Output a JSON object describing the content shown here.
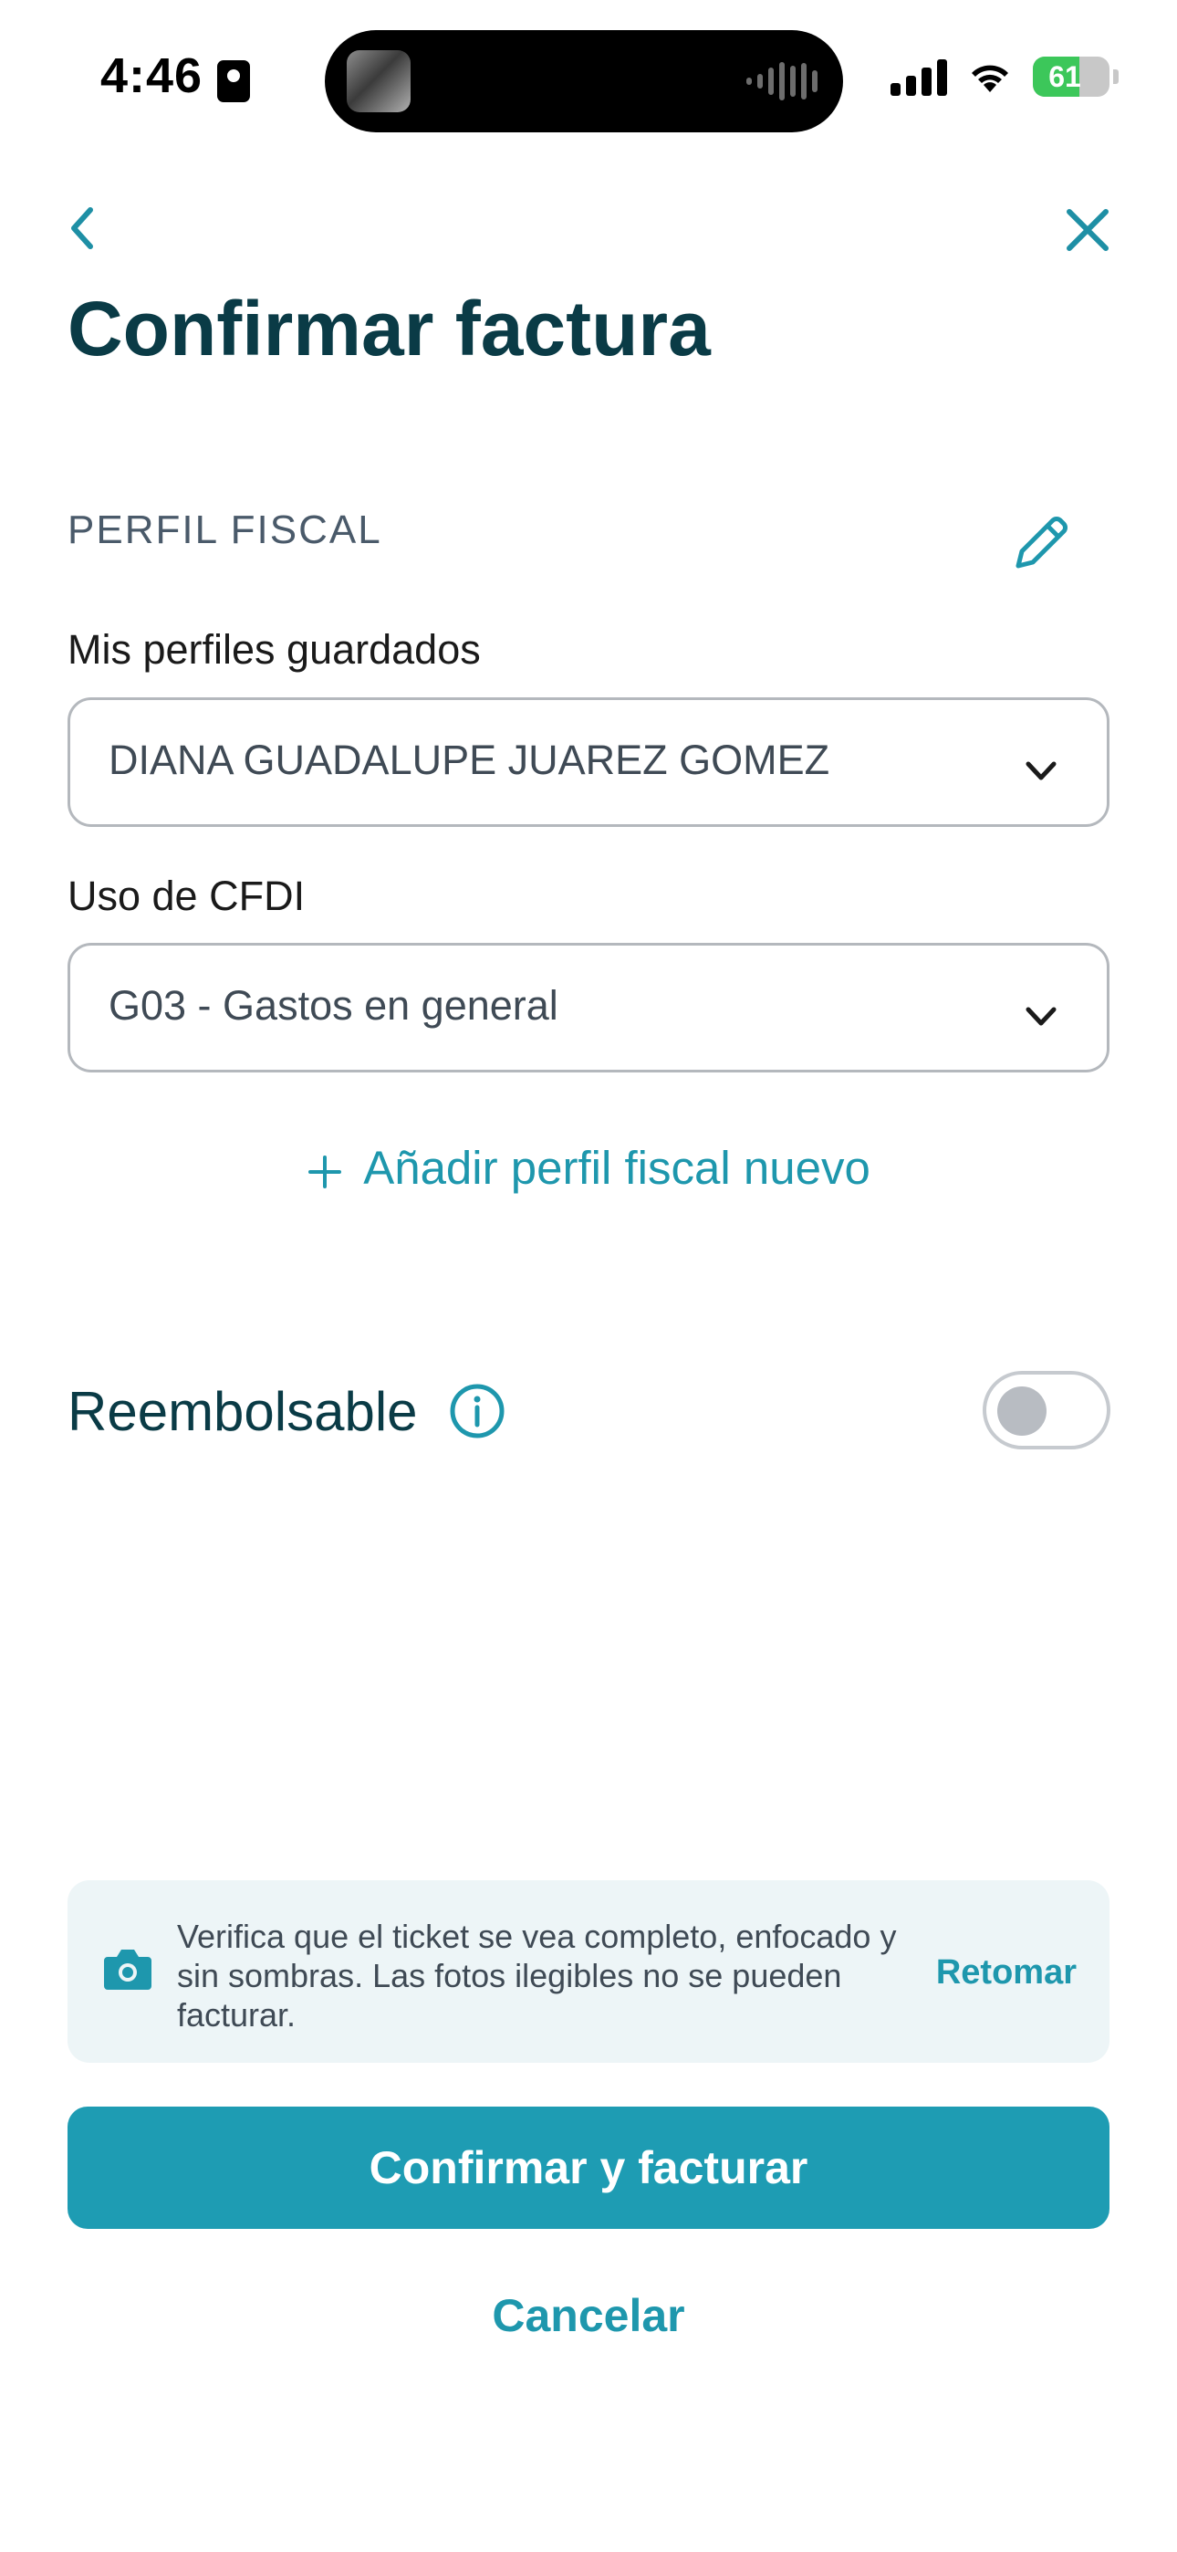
{
  "status_bar": {
    "time": "4:46",
    "battery_level": "61",
    "battery_fill": 0.61,
    "icons": [
      "contact-card-icon",
      "now-playing-artwork",
      "audio-waveform-icon",
      "cellular-signal-icon",
      "wifi-icon",
      "battery-charging-icon"
    ]
  },
  "header": {
    "back_icon": "chevron-left-icon",
    "close_icon": "close-icon",
    "title": "Confirmar factura"
  },
  "fiscal_profile": {
    "section_title": "PERFIL FISCAL",
    "edit_icon": "pencil-icon",
    "saved_profiles_label": "Mis perfiles guardados",
    "saved_profile_value": "DIANA GUADALUPE JUAREZ GOMEZ",
    "cfdi_label": "Uso de CFDI",
    "cfdi_value": "G03 - Gastos en general",
    "add_profile_label": "Añadir perfil fiscal nuevo"
  },
  "reimbursable": {
    "label": "Reembolsable",
    "info_icon": "info-icon",
    "enabled": false
  },
  "ticket_tip": {
    "icon": "camera-icon",
    "message": "Verifica que el ticket se vea completo, enfocado y sin sombras. Las fotos ilegibles no se pueden facturar.",
    "action_label": "Retomar"
  },
  "actions": {
    "confirm_label": "Confirmar y facturar",
    "cancel_label": "Cancelar"
  },
  "colors": {
    "accent": "#1e9cb3",
    "title": "#0a3b46",
    "tip_background": "#edf5f7"
  }
}
